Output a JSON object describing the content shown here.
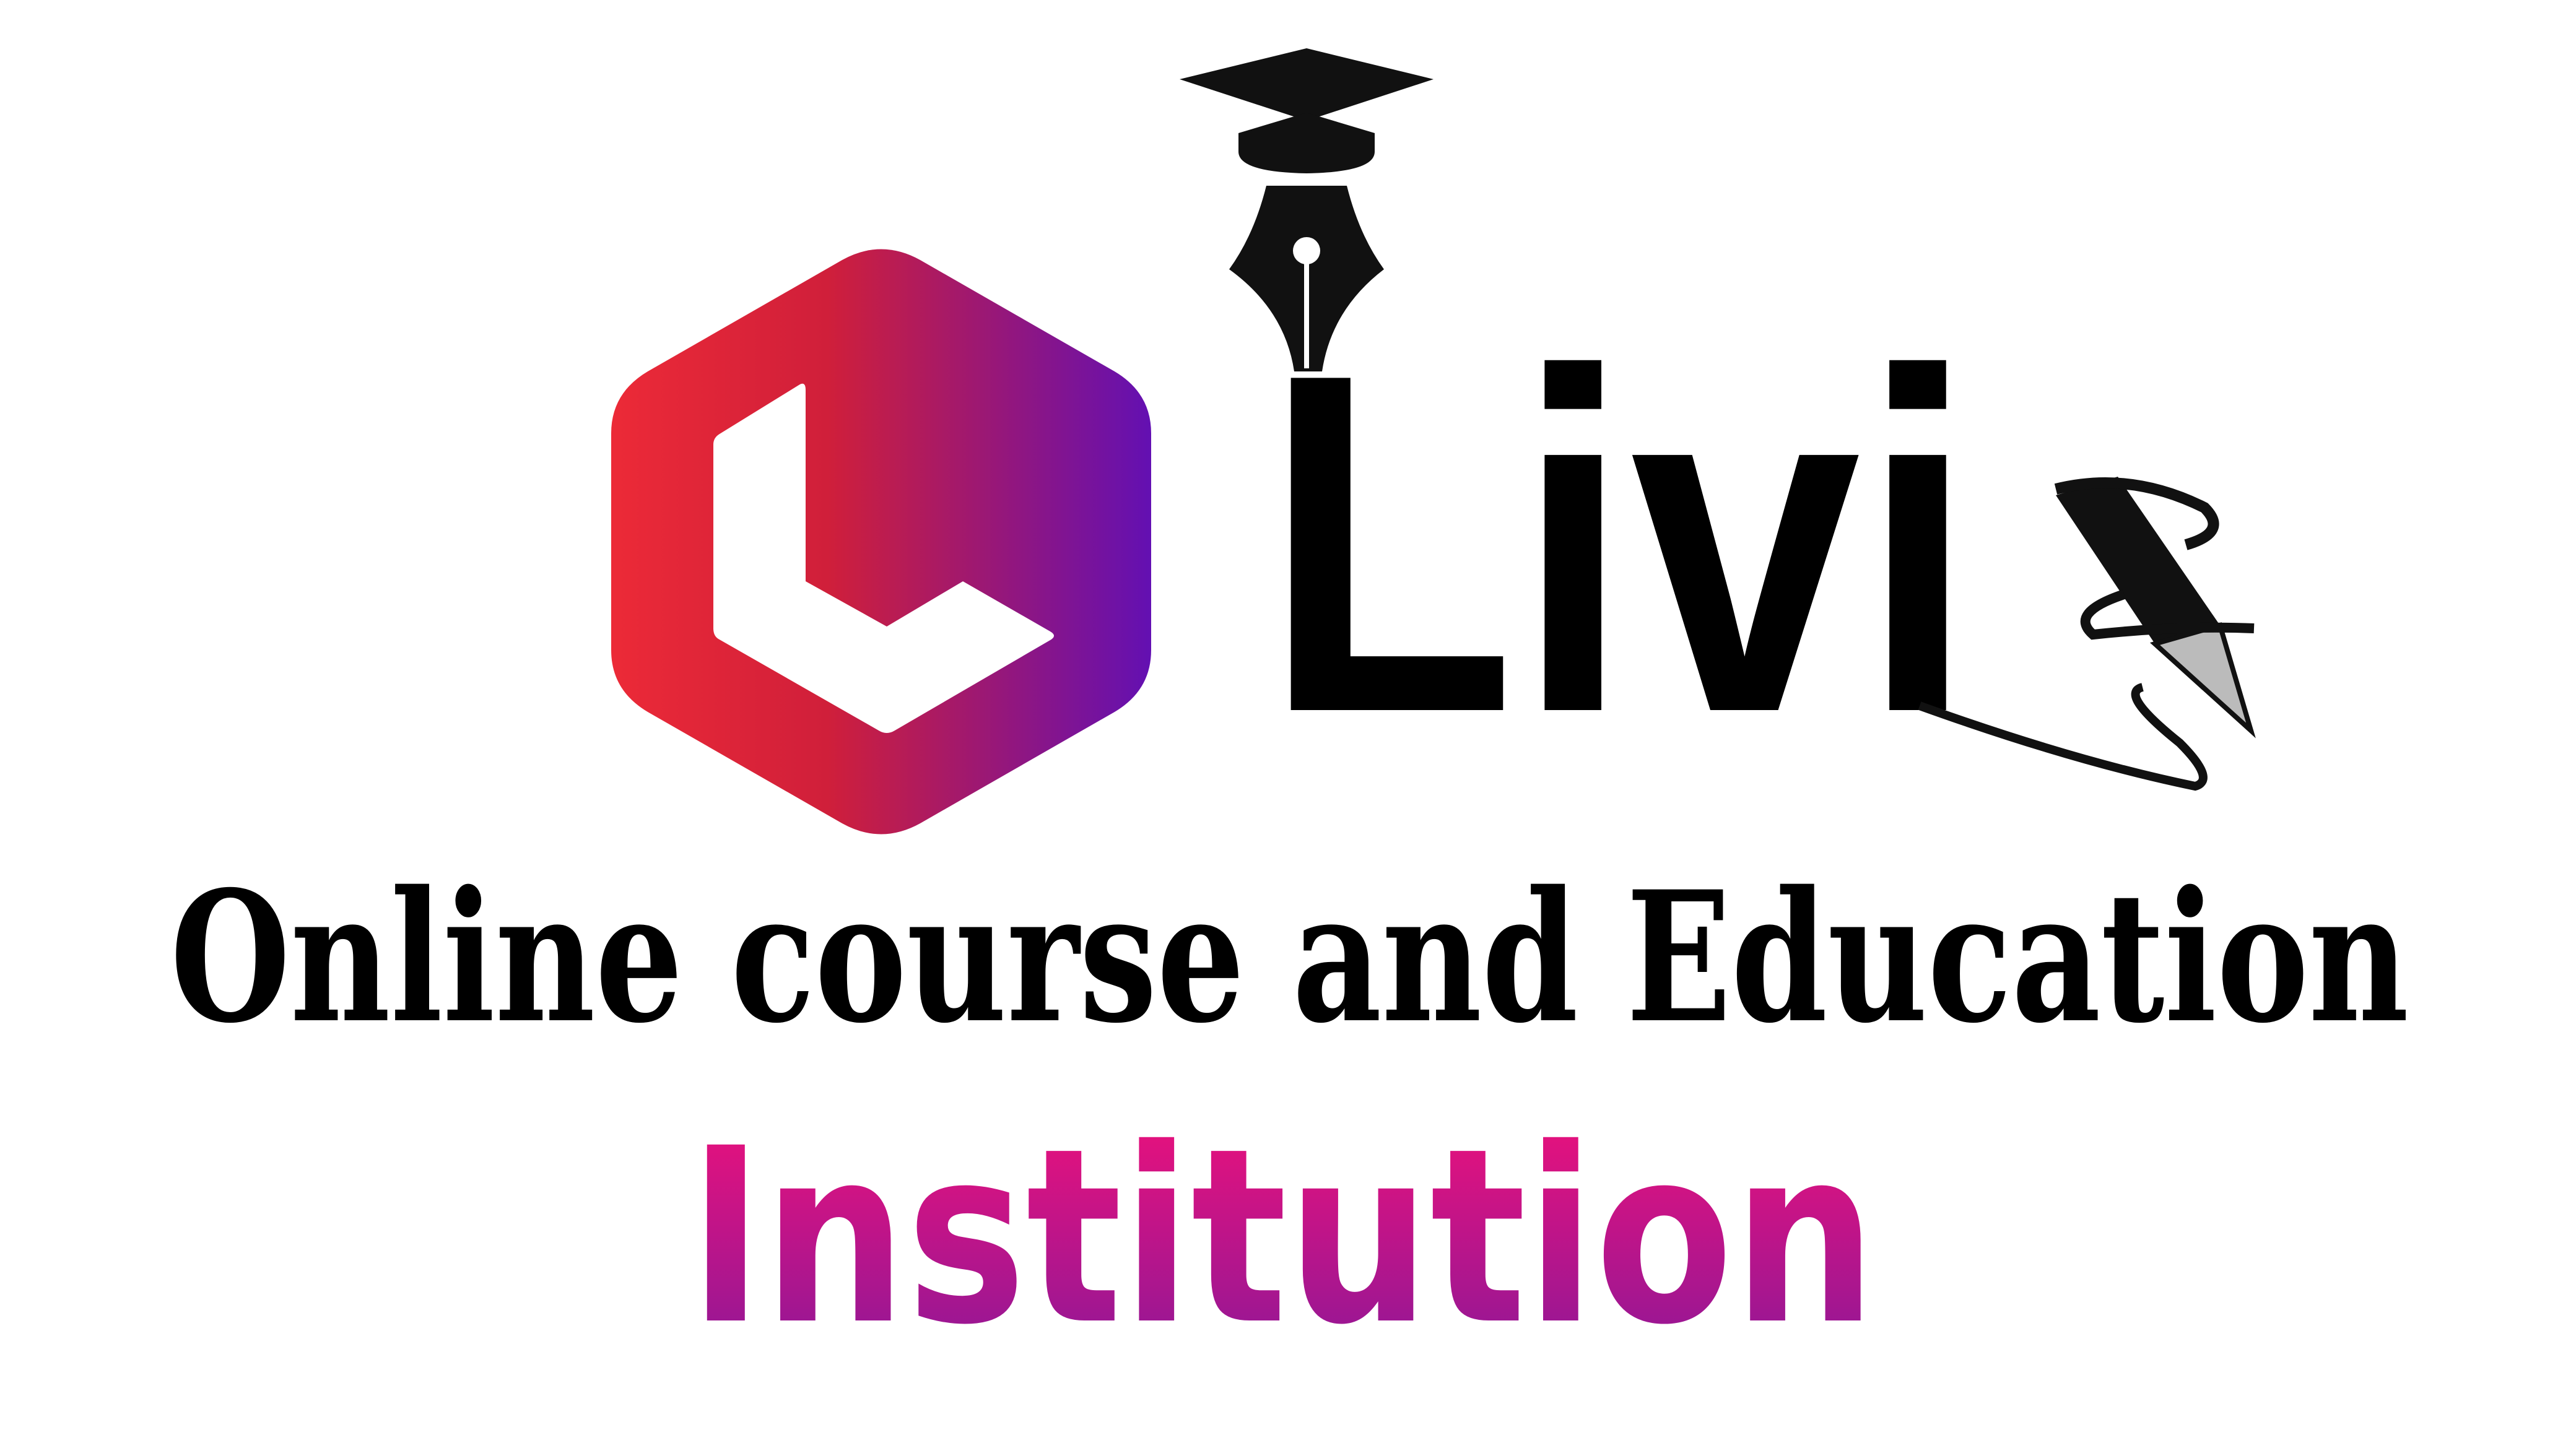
{
  "brand": {
    "name": "Livi",
    "tagline": "Online course and Education",
    "subtitle": "Institution"
  },
  "colors": {
    "hex_start": "#ec2a37",
    "hex_mid": "#d01f3a",
    "hex_end": "#6310b2",
    "inst_top": "#f0117a",
    "inst_bottom": "#8a1898",
    "text": "#000000"
  },
  "icons": [
    "graduation-cap-icon",
    "fountain-pen-nib-icon",
    "pencil-icon",
    "hexagon-l-logo-icon"
  ]
}
